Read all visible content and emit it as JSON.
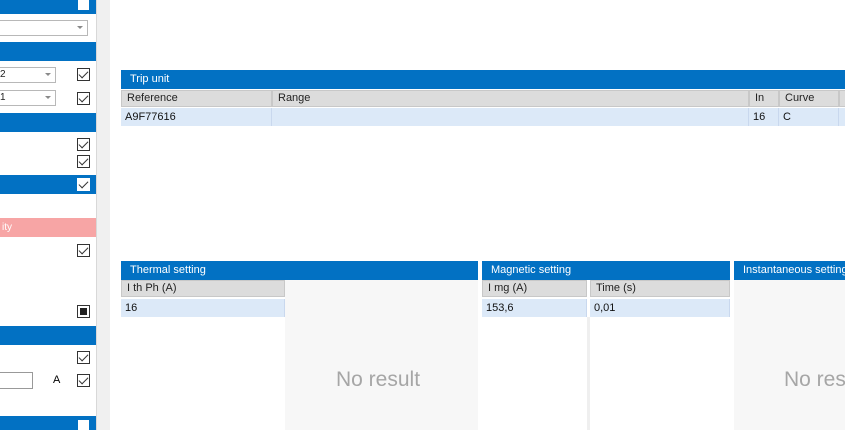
{
  "sidebar": {
    "combo1_value": "2",
    "combo2_value": "1",
    "pink_row_text": "ity",
    "unit_label": "A",
    "checkboxes": {
      "top": "unchecked",
      "combo1": "checked",
      "combo2": "checked",
      "group3_a": "checked",
      "group3_b": "checked",
      "bar4": "checked",
      "group4": "checked",
      "filled": "indeterminate",
      "group5_a": "checked",
      "group5_b": "checked",
      "bottom": "unchecked"
    }
  },
  "trip_unit": {
    "title": "Trip unit",
    "columns": [
      "Reference",
      "Range",
      "In",
      "Curve"
    ],
    "rows": [
      {
        "reference": "A9F77616",
        "range": "",
        "in": "16",
        "curve": "C"
      }
    ]
  },
  "thermal": {
    "title": "Thermal setting",
    "columns": [
      "I th Ph (A)"
    ],
    "rows": [
      [
        "16"
      ]
    ],
    "empty_text": "No result"
  },
  "magnetic": {
    "title": "Magnetic setting",
    "columns": [
      "I mg (A)",
      "Time (s)"
    ],
    "rows": [
      [
        "153,6",
        "0,01"
      ]
    ]
  },
  "instantaneous": {
    "title": "Instantaneous setting",
    "empty_text": "No res"
  },
  "colors": {
    "header_blue": "#0271c3",
    "selected_row": "#dce9f8",
    "warning_pink": "#f7a5a5"
  }
}
